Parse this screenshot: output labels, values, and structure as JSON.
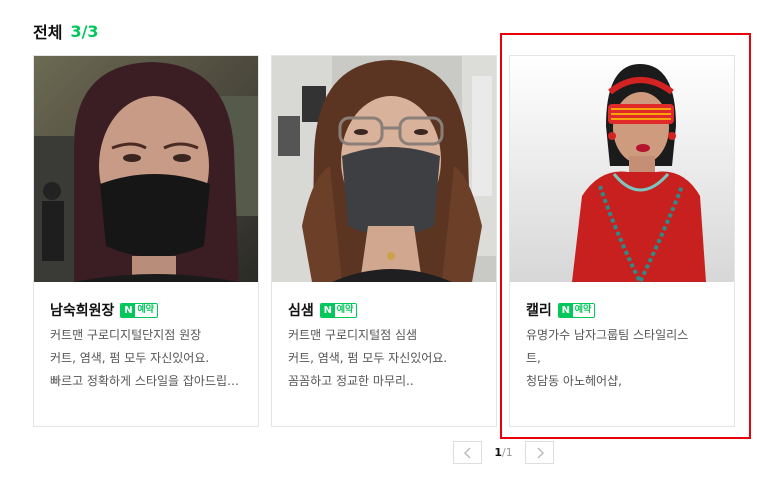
{
  "header": {
    "title": "전체",
    "count": "3/3"
  },
  "colors": {
    "accent": "#03c75a",
    "highlight": "#e8000d"
  },
  "cards": [
    {
      "name": "남숙희원장",
      "badge_n": "N",
      "badge_label": "예약",
      "desc": [
        "커트맨 구로디지털단지점 원장",
        "커트, 염색, 펌 모두 자신있어요.",
        "빠르고 정확하게 스타일을 잡아드립니다"
      ]
    },
    {
      "name": "심샘",
      "badge_n": "N",
      "badge_label": "예약",
      "desc": [
        "커트맨 구로디지털점 심샘",
        "커트, 염색, 펌 모두 자신있어요.",
        "꼼꼼하고 정교한 마무리.."
      ]
    },
    {
      "name": "캘리",
      "badge_n": "N",
      "badge_label": "예약",
      "desc": [
        "유명가수 남자그룹팀 스타일리스",
        "트,",
        "청담동 아노헤어샵,"
      ]
    }
  ],
  "pager": {
    "prev_icon": "chevron-left-icon",
    "current": "1",
    "separator": "/",
    "total": "1",
    "next_icon": "chevron-right-icon"
  }
}
